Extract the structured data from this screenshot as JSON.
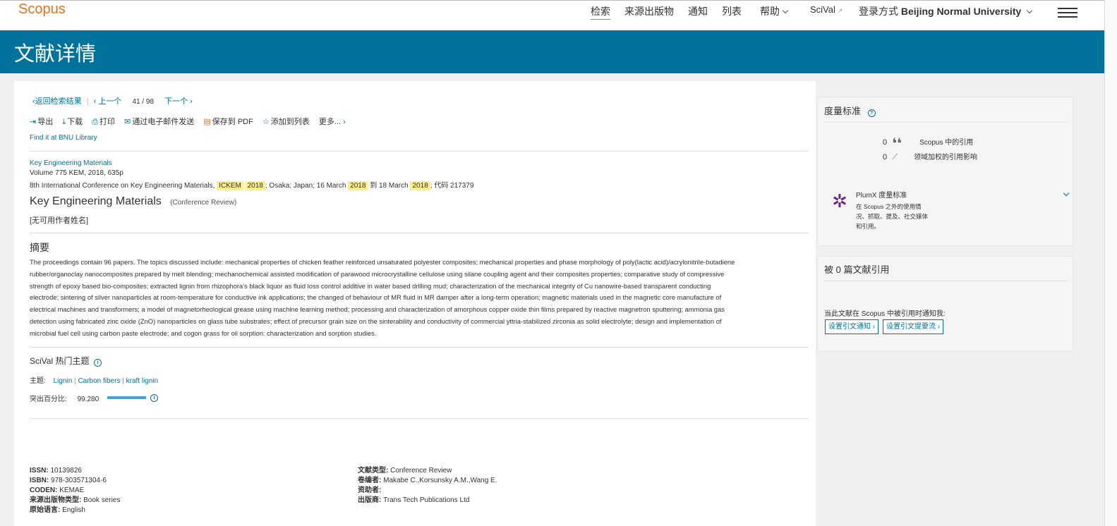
{
  "header": {
    "logo": "Scopus",
    "nav": [
      "检索",
      "来源出版物",
      "通知",
      "列表",
      "帮助",
      "SciVal",
      "登录方式"
    ],
    "scival_arrow": "↗",
    "institution": "Beijing Normal University"
  },
  "banner_title": "文献详情",
  "toolbar": {
    "back": "返回检索结果",
    "prev": "上一个",
    "current": "41",
    "sep": "/",
    "total": "98",
    "next": "下一个",
    "actions": [
      "导出",
      "下载",
      "打印",
      "通过电子邮件发送",
      "保存到 PDF",
      "添加到列表",
      "更多..."
    ],
    "library_link": "Find it at BNU Library"
  },
  "source": {
    "journal": "Key Engineering Materials",
    "volume": "Volume 775 KEM, 2018, 635p",
    "conf_prefix": "8th International Conference on Key Engineering Materials,",
    "conf_acronym": "ICKEM",
    "conf_year": "2018",
    "conf_loc": "; Osaka; Japan; 16 March",
    "conf_year2": "2018",
    "conf_to": "到 18 March",
    "conf_year3": "2018",
    "conf_code": "; 代码 217379"
  },
  "doc_title": "Key Engineering Materials",
  "doc_type_tag": "(Conference Review)",
  "no_author": "[无可用作者姓名]",
  "abstract_heading": "摘要",
  "abstract_lines": [
    "The proceedings contain 96 papers. The topics discussed include: mechanical properties of chicken feather reinforced unsaturated polyester composites; mechanical properties and phase morphology of poly(lactic acid)/acrylonitrile-butadiene",
    "rubber/organoclay nanocomposites prepared by melt blending; mechanochemical assisted modification of parawood microcrystalline cellulose using silane coupling agent and their composites properties; comparative study of compressive",
    "strength of epoxy based bio-composites; extracted lignin from rhizophora's black liquor as fluid loss control additive in water based drilling mud; characterization of the mechanical integrity of Cu nanowire-based transparent conducting",
    "electrode; sintering of silver nanoparticles at room-temperature for conductive ink applications; the changed of behaviour of MR fluid in MR damper after a long-term operation; magnetic materials used in the magnetic core manufacture of",
    "electrical machines and transformers; a model of magnetorheological grease using machine learning method; processing and characterization of amorphous copper oxide thin films prepared by reactive magnetron sputtering; ammonia gas",
    "detection using fabricated zinc oxide (ZnO) nanoparticles on glass tube substrates; effect of precursor grain size on the sinterability and conductivity of commercial yttria-stabilized zirconia as solid electrolyte; design and implementation of",
    "microbial fuel cell using carbon paste electrode; and cogon grass for oil sorption: characterization and sorption studies."
  ],
  "scival": {
    "heading": "SciVal 热门主题",
    "topic_label": "主题:",
    "topics": [
      "Lignin",
      "Carbon fibers",
      "kraft lignin"
    ],
    "topic_sep": "|",
    "percentile_label": "突出百分比:",
    "percentile": "99.280",
    "percentile_fraction": 0.9928
  },
  "details_left": [
    {
      "k": "ISSN:",
      "v": "10139826"
    },
    {
      "k": "ISBN:",
      "v": "978-303571304-6"
    },
    {
      "k": "CODEN:",
      "v": "KEMAE"
    },
    {
      "k": "来源出版物类型:",
      "v": "Book series"
    },
    {
      "k": "原始语言:",
      "v": "English"
    }
  ],
  "details_right": [
    {
      "k": "文献类型:",
      "v": "Conference Review"
    },
    {
      "k": "卷编者:",
      "v": "Makabe C.,Korsunsky A.M.,Wang E."
    },
    {
      "k": "资助者:",
      "v": ""
    },
    {
      "k": "出版商:",
      "v": "Trans Tech Publications Ltd"
    }
  ],
  "metrics": {
    "heading": "度量标准",
    "cited_count": "0",
    "cited_label": "Scopus 中的引用",
    "fwci_count": "0",
    "fwci_label": "领域加权的引用影响",
    "plumx_title": "PlumX 度量标准",
    "plumx_desc": [
      "在 Scopus 之外的使用情",
      "况、抓取、提及、社交媒体",
      "和引用。"
    ]
  },
  "citedby": {
    "heading": "被 0 篇文献引用",
    "notify": "当此文献在 Scopus 中被引用时通知我:",
    "btn_alert": "设置引文通知",
    "btn_feed": "设置引文提要流"
  },
  "colors": {
    "brand": "#e9711c",
    "banner": "#00729b",
    "link": "#007398",
    "highlight": "#fdf08b"
  }
}
